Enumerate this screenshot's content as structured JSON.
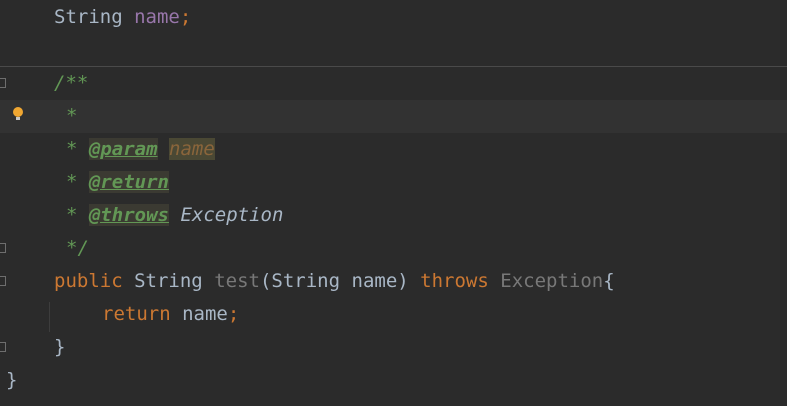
{
  "code": {
    "field_line": {
      "type": "String",
      "name": "name",
      "semicolon": ";"
    },
    "javadoc": {
      "open": "/**",
      "star": "*",
      "param_tag": "@param",
      "param_name": "name",
      "return_tag": "@return",
      "throws_tag": "@throws",
      "throws_type": "Exception",
      "close": "*/"
    },
    "method_line": {
      "modifier": "public",
      "return_type": "String",
      "method_name": "test",
      "open_paren": "(",
      "param_type": "String",
      "param_name": "name",
      "close_paren": ")",
      "throws_kw": "throws",
      "exception": "Exception",
      "open_brace": "{"
    },
    "return_line": {
      "keyword": "return",
      "value": "name",
      "semicolon": ";"
    },
    "method_close": "}",
    "class_close": "}"
  },
  "colors": {
    "background": "#2b2b2b",
    "keyword": "#cc7832",
    "doc": "#629755",
    "field": "#9876aa",
    "text": "#a9b7c6"
  },
  "icons": [
    "lightbulb-icon",
    "fold-marker-icon"
  ]
}
